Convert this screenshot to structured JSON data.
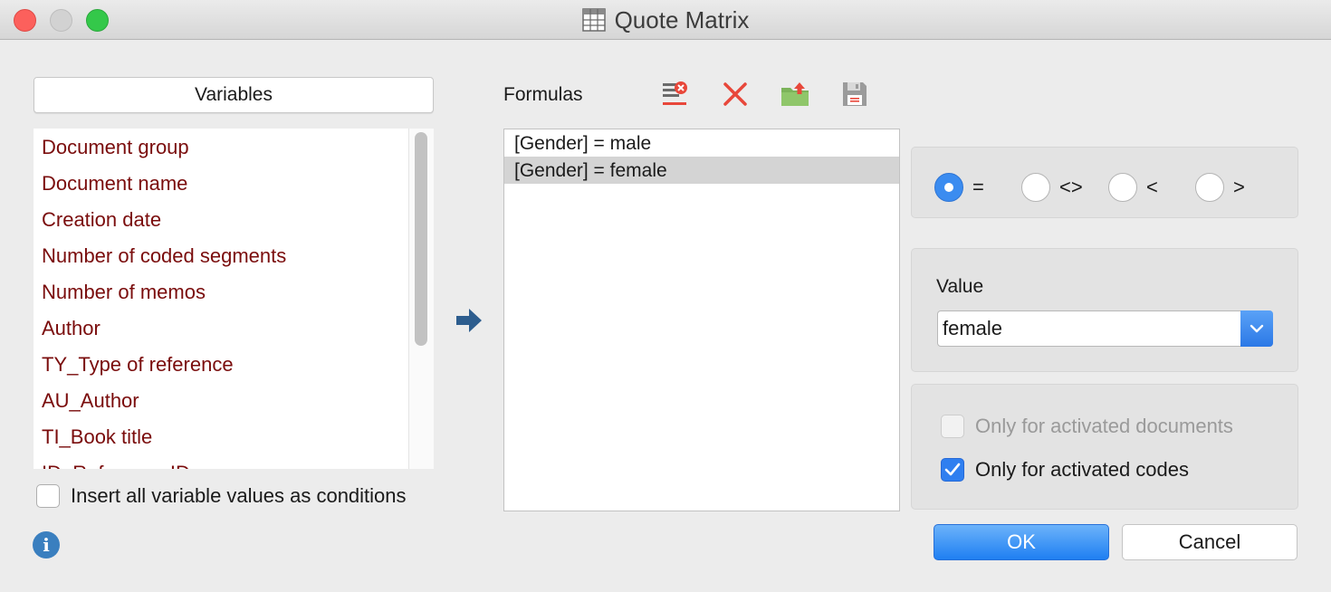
{
  "window": {
    "title": "Quote Matrix"
  },
  "variables": {
    "header": "Variables",
    "items": [
      {
        "label": "Document group"
      },
      {
        "label": "Document name"
      },
      {
        "label": "Creation date"
      },
      {
        "label": "Number of coded segments"
      },
      {
        "label": "Number of memos"
      },
      {
        "label": "Author"
      },
      {
        "label": "TY_Type of reference"
      },
      {
        "label": "AU_Author"
      },
      {
        "label": "TI_Book title"
      },
      {
        "label": "ID_Reference ID"
      }
    ],
    "insert_all_label": "Insert all variable values as conditions",
    "insert_all_checked": false
  },
  "formulas": {
    "label": "Formulas",
    "items": [
      {
        "text": "[Gender] = male"
      },
      {
        "text": "[Gender] = female"
      }
    ],
    "selected_index": 1
  },
  "operators": {
    "options": [
      {
        "label": "="
      },
      {
        "label": "<>"
      },
      {
        "label": "<"
      },
      {
        "label": ">"
      }
    ],
    "selected_index": 0
  },
  "value": {
    "label": "Value",
    "selected": "female"
  },
  "options": {
    "activated_documents": {
      "label": "Only for activated documents",
      "checked": false,
      "enabled": false
    },
    "activated_codes": {
      "label": "Only for activated codes",
      "checked": true,
      "enabled": true
    }
  },
  "buttons": {
    "ok": "OK",
    "cancel": "Cancel"
  },
  "colors": {
    "accent": "#2f7ff0",
    "variable_text": "#7a0c0c",
    "delete_red": "#e8473a"
  }
}
